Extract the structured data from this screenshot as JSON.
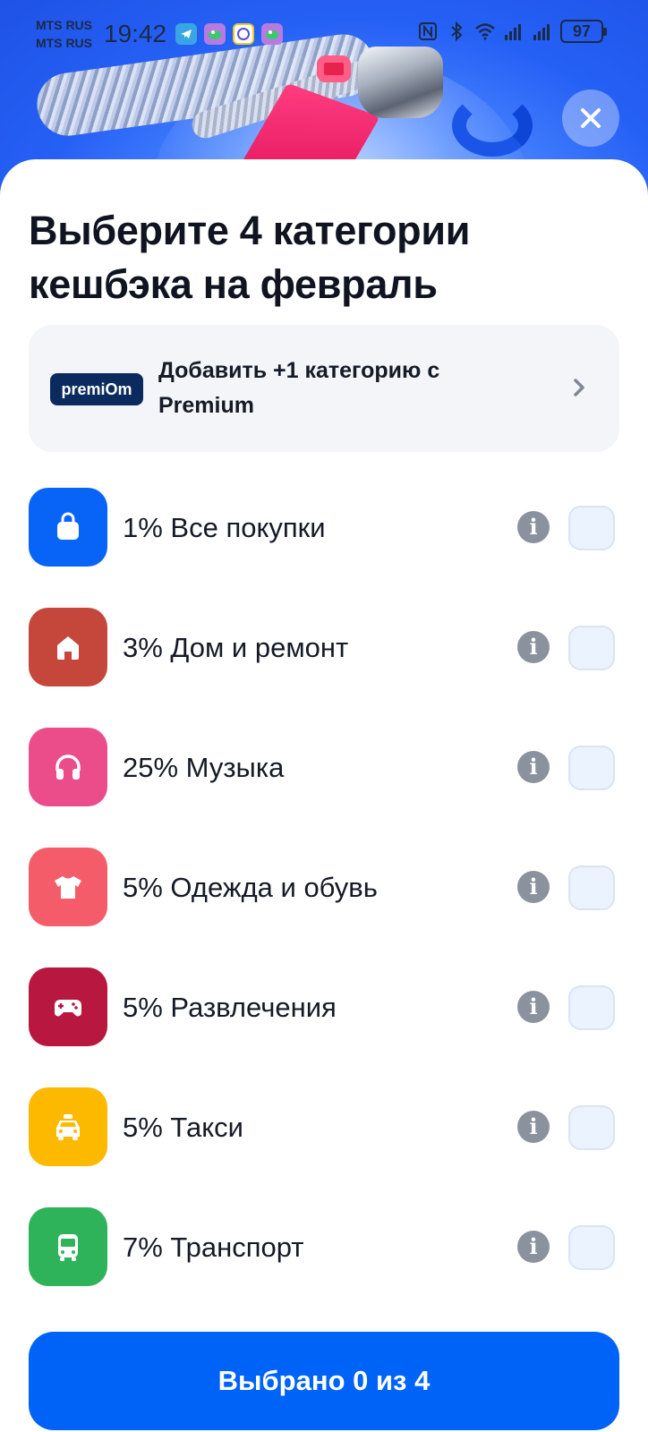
{
  "status_bar": {
    "carrier_1": "MTS RUS",
    "carrier_2": "MTS RUS",
    "time": "19:42",
    "battery": "97",
    "app_icons": [
      "telegram-icon",
      "croc-app-icon",
      "yandex-coin-icon",
      "croc-app-icon"
    ],
    "system_icons": [
      "nfc-icon",
      "bluetooth-icon",
      "wifi-icon",
      "signal-icon",
      "signal-icon"
    ]
  },
  "sheet": {
    "title": "Выберите 4 категории кешбэка на февраль",
    "premium": {
      "logo_text": "premiOm",
      "text": "Добавить +1 категорию с Premium"
    },
    "categories": [
      {
        "label": "1% Все покупки",
        "icon": "shopping-bag-icon",
        "color": "#0863f7"
      },
      {
        "label": "3% Дом и ремонт",
        "icon": "home-icon",
        "color": "#c5463a"
      },
      {
        "label": "25% Музыка",
        "icon": "headphones-icon",
        "color": "#ea4d8a"
      },
      {
        "label": "5% Одежда и обувь",
        "icon": "tshirt-icon",
        "color": "#f45c69"
      },
      {
        "label": "5% Развлечения",
        "icon": "gamepad-icon",
        "color": "#b8173f"
      },
      {
        "label": "5% Такси",
        "icon": "taxi-icon",
        "color": "#fdb800"
      },
      {
        "label": "7% Транспорт",
        "icon": "bus-icon",
        "color": "#2fb35a"
      }
    ],
    "cta": "Выбрано 0 из 4"
  },
  "colors": {
    "accent": "#0063f7",
    "banner": "#2560f5",
    "checkbox_bg": "#eaf3ff",
    "info_icon": "#8a929e"
  }
}
